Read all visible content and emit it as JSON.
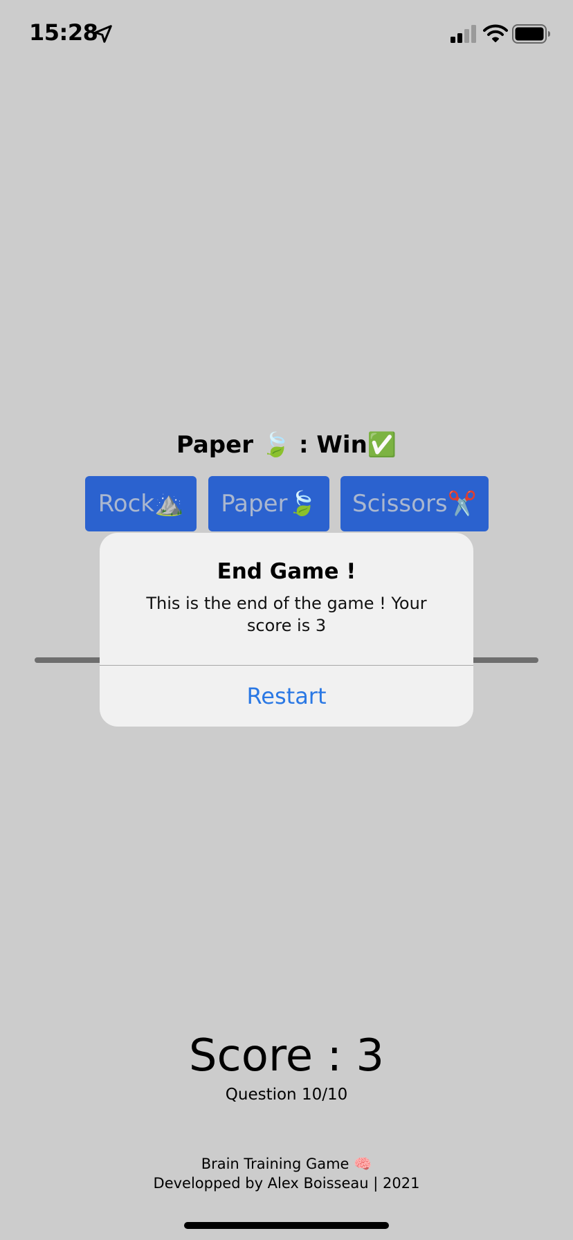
{
  "status_bar": {
    "time": "15:28",
    "icons": [
      "location-arrow-icon",
      "cellular-signal-icon",
      "wifi-icon",
      "battery-icon"
    ]
  },
  "result": {
    "text": "Paper 🍃 : Win✅"
  },
  "choices": [
    {
      "label": "Rock⛰️"
    },
    {
      "label": "Paper🍃"
    },
    {
      "label": "Scissors✂️"
    }
  ],
  "progress": {
    "value": 1.0
  },
  "alert": {
    "title": "End Game !",
    "message": "This is the end of the game ! Your score is 3",
    "button_label": "Restart"
  },
  "score": {
    "label": "Score : 3",
    "question": "Question 10/10"
  },
  "footer": {
    "line1": "Brain Training Game 🧠",
    "line2": "Developped by Alex Boisseau | 2021"
  },
  "colors": {
    "background": "#cccccc",
    "button_blue": "#2b62cf",
    "alert_background": "#f1f1f1",
    "alert_action": "#2a78e4"
  }
}
